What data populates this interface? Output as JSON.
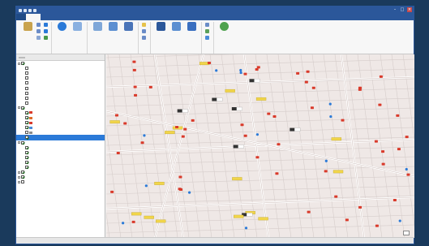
{
  "colors": {
    "accent": "#2b579a",
    "road_major": "#ffffff",
    "road_minor": "#d6cdcb",
    "poi_red": "#d93a2b",
    "poi_yellow": "#f1d54a",
    "selection": "#2b7ad8"
  },
  "window": {
    "title": "",
    "controls": [
      "minimize-icon",
      "maximize-icon",
      "close-icon"
    ]
  },
  "ribbon": {
    "tabs": [
      {
        "label": ""
      },
      {
        "label": ""
      },
      {
        "label": ""
      },
      {
        "label": ""
      },
      {
        "label": ""
      },
      {
        "label": ""
      }
    ],
    "active_tab_index": 1,
    "groups": [
      {
        "name": "clipboard",
        "label": "",
        "items": [
          {
            "label": "",
            "icon": "paste-icon"
          },
          {
            "label": "",
            "icon": "cut-icon"
          },
          {
            "label": "",
            "icon": "copy-icon"
          }
        ]
      },
      {
        "name": "navigate",
        "label": "",
        "items": [
          {
            "label": "",
            "icon": "explore-icon"
          },
          {
            "label": "",
            "icon": "bookmarks-icon"
          }
        ]
      },
      {
        "name": "layer",
        "label": "",
        "items": [
          {
            "label": "",
            "icon": "basemap-icon"
          },
          {
            "label": "",
            "icon": "add-data-icon"
          },
          {
            "label": "",
            "icon": "add-preset-icon"
          }
        ]
      },
      {
        "name": "selection",
        "label": "",
        "items": [
          {
            "label": "",
            "icon": "select-icon"
          },
          {
            "label": "",
            "icon": "select-by-attr-icon"
          },
          {
            "label": "",
            "icon": "select-by-loc-icon"
          }
        ]
      },
      {
        "name": "inquiry",
        "label": "",
        "items": [
          {
            "label": "",
            "icon": "measure-icon"
          },
          {
            "label": "",
            "icon": "locate-icon"
          },
          {
            "label": "",
            "icon": "infographics-icon"
          }
        ]
      },
      {
        "name": "labeling",
        "label": "",
        "items": [
          {
            "label": "",
            "icon": "label-icon"
          },
          {
            "label": "",
            "icon": "convert-icon"
          },
          {
            "label": "",
            "icon": "download-icon"
          }
        ]
      },
      {
        "name": "offline",
        "label": "",
        "items": [
          {
            "label": "",
            "icon": "sync-icon"
          }
        ]
      }
    ]
  },
  "contents": {
    "tabs": [
      {
        "label": ""
      },
      {
        "label": ""
      }
    ],
    "rows": [
      {
        "level": 0,
        "checked": true,
        "label": ""
      },
      {
        "level": 1,
        "checked": false,
        "label": ""
      },
      {
        "level": 1,
        "checked": false,
        "label": ""
      },
      {
        "level": 1,
        "checked": false,
        "label": ""
      },
      {
        "level": 1,
        "checked": false,
        "label": ""
      },
      {
        "level": 1,
        "checked": false,
        "label": ""
      },
      {
        "level": 1,
        "checked": false,
        "label": ""
      },
      {
        "level": 1,
        "checked": false,
        "label": ""
      },
      {
        "level": 1,
        "checked": false,
        "label": ""
      },
      {
        "level": 0,
        "checked": true,
        "label": ""
      },
      {
        "level": 1,
        "checked": true,
        "label": "",
        "swatch": "#d93a2b"
      },
      {
        "level": 1,
        "checked": true,
        "label": "",
        "swatch": "#e06b2a"
      },
      {
        "level": 1,
        "checked": true,
        "label": "",
        "swatch": "#d93a2b"
      },
      {
        "level": 1,
        "checked": true,
        "label": "",
        "swatch": "#4a8bd8"
      },
      {
        "level": 1,
        "checked": false,
        "label": "",
        "swatch": "#8c8c8c"
      },
      {
        "level": 1,
        "checked": true,
        "label": "",
        "swatch": "#2b7ad8",
        "selected": true
      },
      {
        "level": 0,
        "checked": true,
        "label": ""
      },
      {
        "level": 1,
        "checked": true,
        "label": ""
      },
      {
        "level": 1,
        "checked": true,
        "label": ""
      },
      {
        "level": 1,
        "checked": true,
        "label": ""
      },
      {
        "level": 1,
        "checked": true,
        "label": ""
      },
      {
        "level": 1,
        "checked": true,
        "label": ""
      },
      {
        "level": 0,
        "checked": true,
        "label": ""
      },
      {
        "level": 0,
        "checked": true,
        "label": ""
      },
      {
        "level": 0,
        "checked": false,
        "label": ""
      }
    ]
  },
  "map": {
    "scale_bar": ""
  },
  "status": {
    "items": [
      "",
      "",
      "",
      ""
    ]
  }
}
